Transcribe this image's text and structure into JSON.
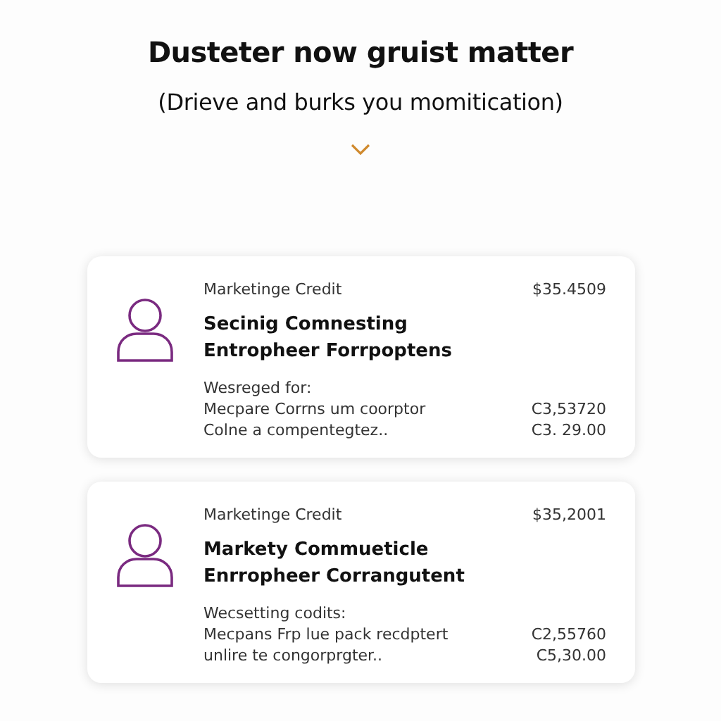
{
  "heading": "Dusteter now gruist matter",
  "subheading": "(Drieve and burks you momitication)",
  "cards": [
    {
      "label": "Marketinge Credit",
      "amount": "$35.4509",
      "title_lines": [
        "Secinig Comnesting",
        "Entropheer Forrpoptens"
      ],
      "note": "Wesreged for:",
      "lines": [
        {
          "text": "Mecpare Corrns um coorptor",
          "amount": "C3,53720"
        },
        {
          "text": "Colne a compentegtez..",
          "amount": "C3. 29.00"
        }
      ]
    },
    {
      "label": "Marketinge Credit",
      "amount": "$35,2001",
      "title_lines": [
        "Markety Commueticle",
        "Enrropheer Corrangutent"
      ],
      "note": "Wecsetting codits:",
      "lines": [
        {
          "text": "Mecpans Frp lue pack recdptert",
          "amount": "C2,55760"
        },
        {
          "text": "unlire te congorprgter..",
          "amount": "C5,30.00"
        }
      ]
    }
  ]
}
